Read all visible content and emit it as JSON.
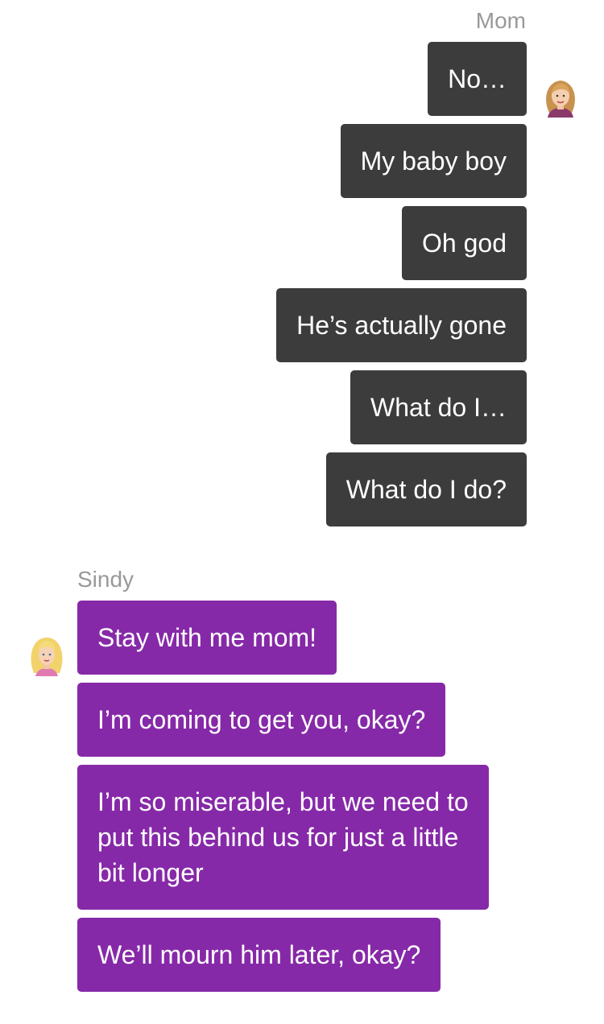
{
  "conversation": {
    "mom": {
      "name": "Mom",
      "avatar_icon": "woman-avatar-icon",
      "bubble_color": "#3c3c3c",
      "messages": [
        "No…",
        "My baby boy",
        "Oh god",
        "He’s actually gone",
        "What do I…",
        "What do I do?"
      ]
    },
    "sindy": {
      "name": "Sindy",
      "avatar_icon": "girl-avatar-icon",
      "bubble_color": "#8629a8",
      "messages": [
        "Stay with me mom!",
        "I’m coming to get you, okay?",
        "I’m so miserable, but we need to\nput this behind us for just a little\nbit longer",
        "We’ll mourn him later, okay?"
      ]
    }
  }
}
